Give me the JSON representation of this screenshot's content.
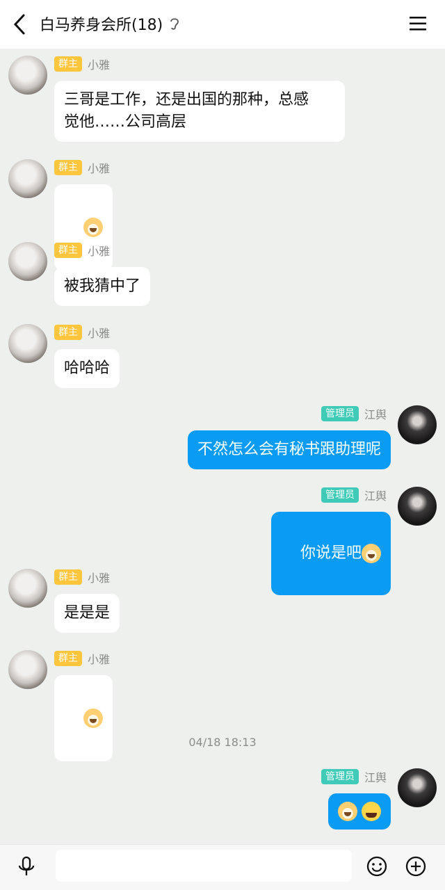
{
  "header": {
    "title": "白马养身会所(18)"
  },
  "messages": [
    {
      "side": "left",
      "badge": "群主",
      "name": "小雅",
      "text": "三哥是工作，还是出国的那种，总感\n觉他……公司高层"
    },
    {
      "side": "left",
      "badge": "群主",
      "name": "小雅",
      "text": ""
    },
    {
      "side": "left",
      "badge": "群主",
      "name": "小雅",
      "text": "被我猜中了"
    },
    {
      "side": "left",
      "badge": "群主",
      "name": "小雅",
      "text": "哈哈哈"
    },
    {
      "side": "right",
      "badge": "管理员",
      "name": "江舆",
      "text": "不然怎么会有秘书跟助理呢"
    },
    {
      "side": "right",
      "badge": "管理员",
      "name": "江舆",
      "text": "你说是吧"
    },
    {
      "side": "left",
      "badge": "群主",
      "name": "小雅",
      "text": "是是是"
    },
    {
      "side": "left",
      "badge": "群主",
      "name": "小雅",
      "text": ""
    },
    {
      "side": "right",
      "badge": "管理员",
      "name": "江舆",
      "text": ""
    }
  ],
  "timestamp": "04/18 18:13",
  "input": {
    "placeholder": ""
  },
  "colors": {
    "outgoing": "#0a9bf5",
    "owner_badge": "#ffc53d",
    "admin_badge": "#3fcbb7"
  }
}
